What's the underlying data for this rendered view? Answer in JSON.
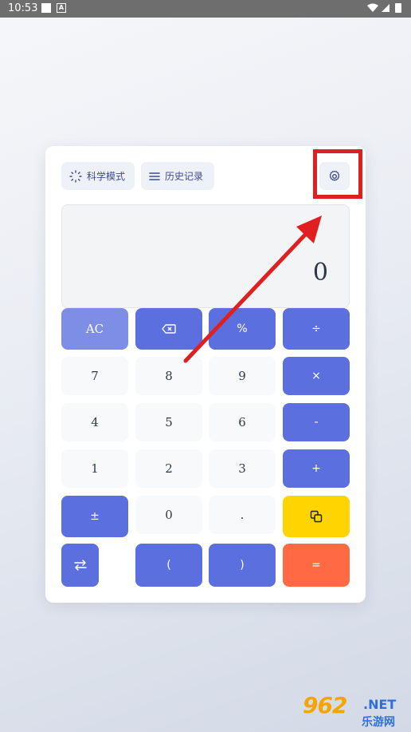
{
  "status_bar": {
    "time": "10:53",
    "battery_icon": "battery-charging-icon",
    "wifi_icon": "wifi-icon",
    "signal_icon": "cell-signal-icon"
  },
  "toolbar": {
    "scientific_label": "科学模式",
    "history_label": "历史记录",
    "settings_icon": "gear-icon"
  },
  "display": {
    "value": "0"
  },
  "keys": {
    "ac": "AC",
    "backspace_icon": "backspace-icon",
    "percent": "%",
    "divide": "÷",
    "seven": "7",
    "eight": "8",
    "nine": "9",
    "multiply": "×",
    "four": "4",
    "five": "5",
    "six": "6",
    "minus": "-",
    "one": "1",
    "two": "2",
    "three": "3",
    "plus": "+",
    "sign": "±",
    "zero": "0",
    "dot": ".",
    "copy_icon": "copy-icon",
    "swap_icon": "swap-arrows-icon",
    "open_paren": "(",
    "close_paren": ")",
    "equals": "="
  },
  "watermark": {
    "main": "962",
    "suffix": ".NET",
    "sub": "乐游网"
  },
  "colors": {
    "operator": "#5b6fdf",
    "clear": "#7e8ee6",
    "copy": "#ffd400",
    "equals": "#ff6a45",
    "highlight": "#e02020"
  }
}
